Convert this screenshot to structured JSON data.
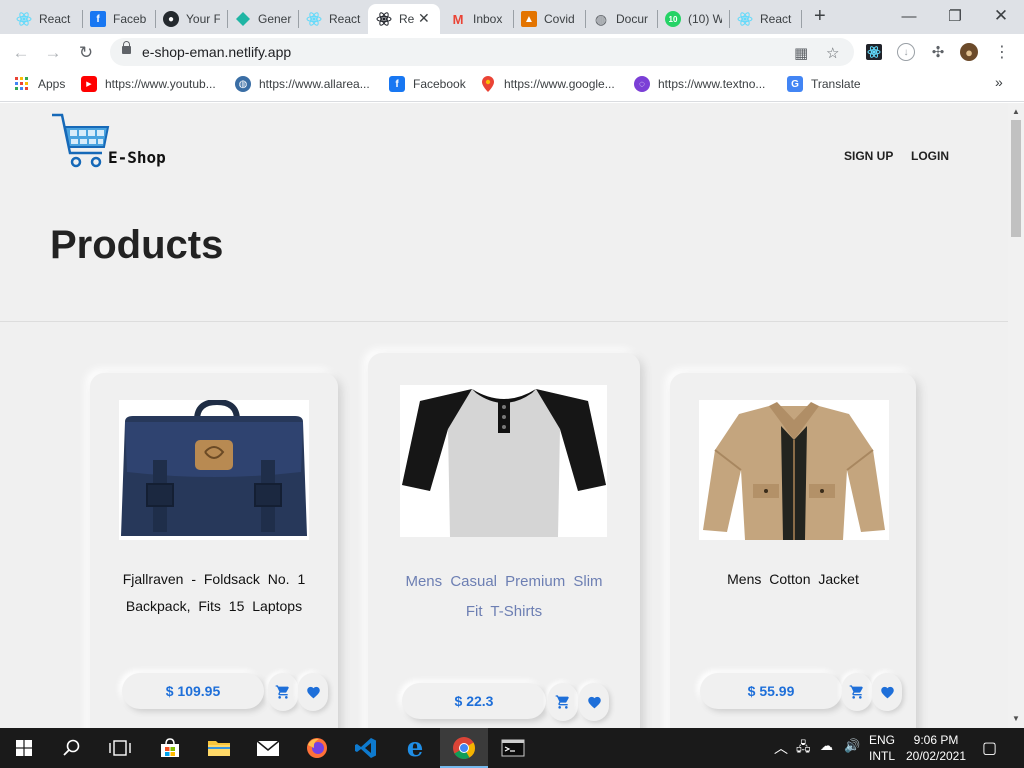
{
  "browser": {
    "tabs": [
      {
        "label": "React",
        "icon": "react-icon"
      },
      {
        "label": "Faceb",
        "icon": "facebook-icon"
      },
      {
        "label": "Your F",
        "icon": "github-icon"
      },
      {
        "label": "Gener",
        "icon": "diamond-icon"
      },
      {
        "label": "React",
        "icon": "react-icon"
      },
      {
        "label": "Re",
        "icon": "react-icon",
        "active": true
      },
      {
        "label": "Inbox",
        "icon": "gmail-icon"
      },
      {
        "label": "Covid",
        "icon": "contact-icon"
      },
      {
        "label": "Docur",
        "icon": "globe-icon"
      },
      {
        "label": "(10) W",
        "icon": "whatsapp-icon",
        "badge": "10"
      },
      {
        "label": "React",
        "icon": "react-icon"
      }
    ],
    "new_tab_label": "+",
    "window_controls": {
      "minimize": "—",
      "maximize": "❐",
      "close": "✕"
    },
    "url": "e-shop-eman.netlify.app",
    "bookmarks": [
      {
        "label": "Apps",
        "icon": "apps-grid-icon"
      },
      {
        "label": "https://www.youtub...",
        "icon": "youtube-icon"
      },
      {
        "label": "https://www.allarea...",
        "icon": "globe-icon"
      },
      {
        "label": "Facebook",
        "icon": "facebook-icon"
      },
      {
        "label": "https://www.google...",
        "icon": "maps-pin-icon"
      },
      {
        "label": "https://www.textno...",
        "icon": "chat-icon"
      },
      {
        "label": "Translate",
        "icon": "translate-icon"
      }
    ],
    "bookmarks_more": "»"
  },
  "site": {
    "logo_text": "E-Shop",
    "nav": {
      "signup": "SIGN UP",
      "login": "LOGIN"
    },
    "heading": "Products",
    "accent_color": "#1e6fd9",
    "products": [
      {
        "title": "Fjallraven - Foldsack No. 1 Backpack, Fits 15 Laptops",
        "price": "$ 109.95",
        "image": "backpack"
      },
      {
        "title": "Mens Casual Premium Slim Fit T-Shirts",
        "price": "$ 22.3",
        "image": "tshirt",
        "featured": true
      },
      {
        "title": "Mens Cotton Jacket",
        "price": "$ 55.99",
        "image": "jacket"
      }
    ]
  },
  "taskbar": {
    "items": [
      "windows-start-icon",
      "search-icon",
      "task-view-icon",
      "store-icon",
      "file-explorer-icon",
      "mail-icon",
      "firefox-icon",
      "vscode-icon",
      "edge-icon",
      "chrome-icon",
      "terminal-icon"
    ],
    "language": {
      "line1": "ENG",
      "line2": "INTL"
    },
    "time": "9:06 PM",
    "date": "20/02/2021"
  }
}
